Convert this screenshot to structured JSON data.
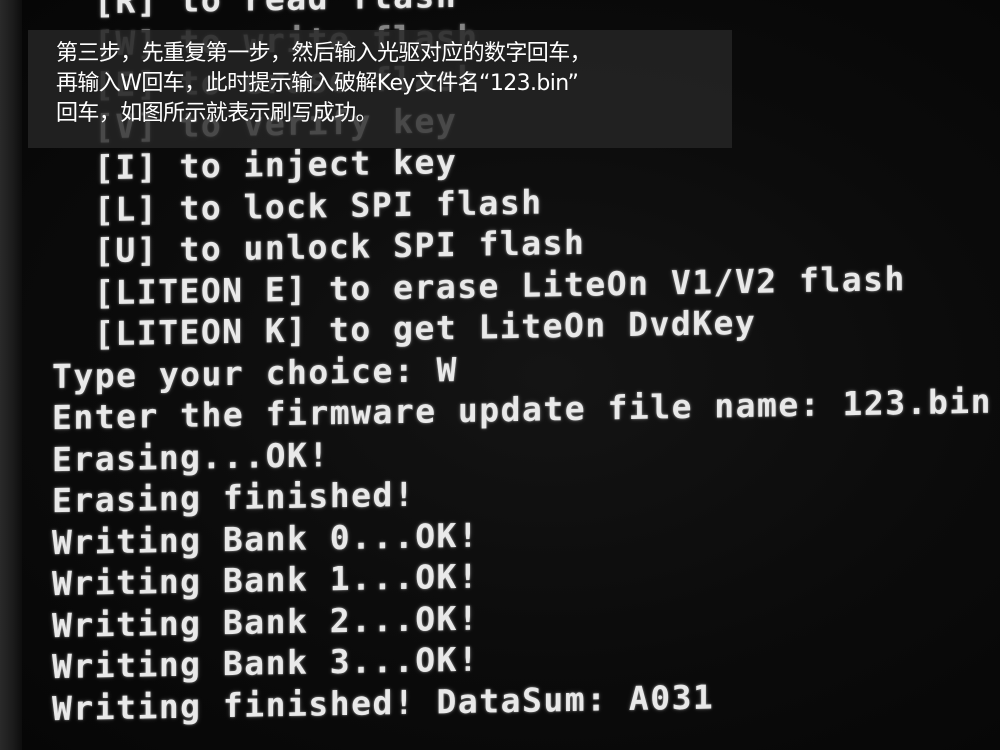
{
  "caption": {
    "lines": [
      "第三步，先重复第一步，然后输入光驱对应的数字回车，",
      "再输入W回车，此时提示输入破解Key文件名“123.bin”",
      "回车，如图所示就表示刷写成功。"
    ]
  },
  "terminal": {
    "menu": [
      "[R] to read flash",
      "[W] to write flash",
      "[E] to erase flash",
      "[V] to verify key",
      "[I] to inject key",
      "[L] to lock SPI flash",
      "[U] to unlock SPI flash",
      "[LITEON E] to erase LiteOn V1/V2 flash",
      "[LITEON K] to get LiteOn DvdKey"
    ],
    "output": [
      "Type your choice: W",
      "Enter the firmware update file name: 123.bin",
      "Erasing...OK!",
      "Erasing finished!",
      "Writing Bank 0...OK!",
      "Writing Bank 1...OK!",
      "Writing Bank 2...OK!",
      "Writing Bank 3...OK!",
      "Writing finished! DataSum: A031"
    ]
  }
}
